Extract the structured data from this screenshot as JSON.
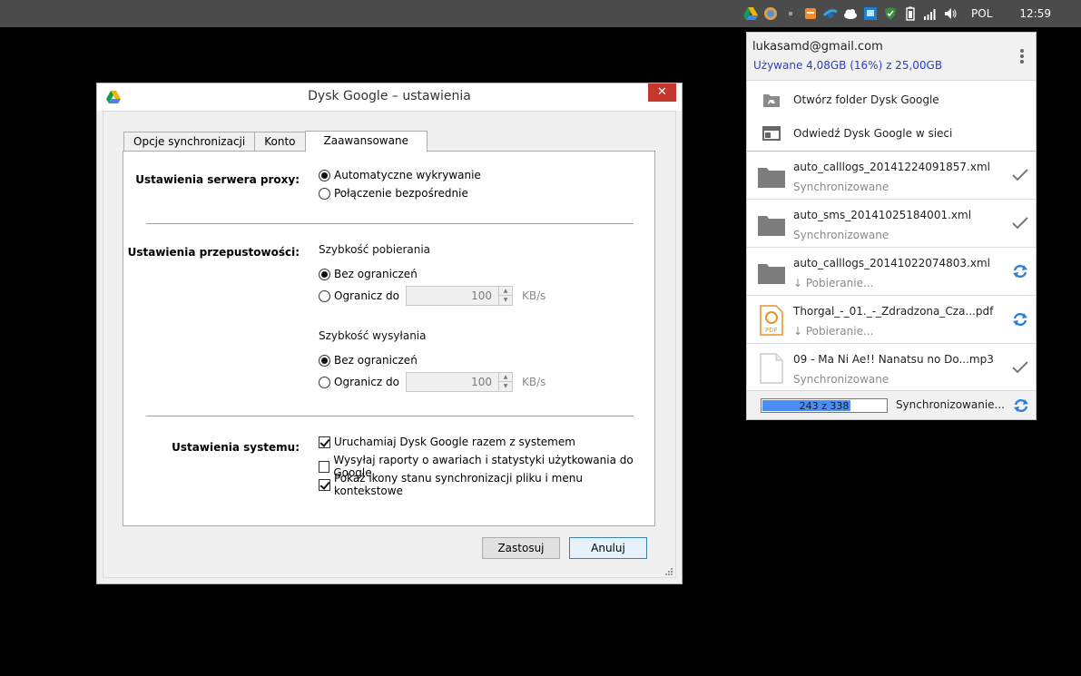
{
  "taskbar": {
    "tray_icons": [
      "google-drive-icon",
      "browser-icon",
      "small-app-icon",
      "orange-app-icon",
      "network-app-icon",
      "cloud-icon",
      "monitor-app-icon",
      "security-shield-icon",
      "battery-icon",
      "signal-bars-icon",
      "volume-icon"
    ],
    "language": "POL",
    "clock": "12:59"
  },
  "window": {
    "title": "Dysk Google – ustawienia",
    "close_label": "✕",
    "tabs": [
      {
        "label": "Opcje synchronizacji",
        "active": false
      },
      {
        "label": "Konto",
        "active": false
      },
      {
        "label": "Zaawansowane",
        "active": true
      }
    ],
    "proxy": {
      "label": "Ustawienia serwera proxy:",
      "options": [
        {
          "label": "Automatyczne wykrywanie",
          "selected": true
        },
        {
          "label": "Połączenie bezpośrednie",
          "selected": false
        }
      ]
    },
    "bandwidth": {
      "label": "Ustawienia przepustowości:",
      "download": {
        "title": "Szybkość pobierania",
        "unlimited_label": "Bez ograniczeń",
        "limit_label": "Ogranicz do",
        "value": "100",
        "unit": "KB/s",
        "selected": "unlimited"
      },
      "upload": {
        "title": "Szybkość wysyłania",
        "unlimited_label": "Bez ograniczeń",
        "limit_label": "Ogranicz do",
        "value": "100",
        "unit": "KB/s",
        "selected": "unlimited"
      }
    },
    "system": {
      "label": "Ustawienia systemu:",
      "options": [
        {
          "label": "Uruchamiaj Dysk Google razem z systemem",
          "checked": true
        },
        {
          "label": "Wysyłaj raporty o awariach i statystyki użytkowania do Google",
          "checked": false
        },
        {
          "label": "Pokaż ikony stanu synchronizacji pliku i menu kontekstowe",
          "checked": true
        }
      ]
    },
    "buttons": {
      "apply": "Zastosuj",
      "cancel": "Anuluj"
    }
  },
  "popup": {
    "email": "lukasamd@gmail.com",
    "usage": "Używane 4,08GB (16%) z 25,00GB",
    "actions": [
      {
        "label": "Otwórz folder Dysk Google",
        "icon": "drive-folder-icon"
      },
      {
        "label": "Odwiedź Dysk Google w sieci",
        "icon": "browser-window-icon"
      }
    ],
    "files": [
      {
        "name": "auto_calllogs_20141224091857.xml",
        "status": "Synchronizowane",
        "icon": "folder-icon",
        "state": "synced"
      },
      {
        "name": "auto_sms_20141025184001.xml",
        "status": "Synchronizowane",
        "icon": "folder-icon",
        "state": "synced"
      },
      {
        "name": "auto_calllogs_20141022074803.xml",
        "status": "↓ Pobieranie...",
        "icon": "folder-icon",
        "state": "syncing"
      },
      {
        "name": "Thorgal_-_01._-_Zdradzona_Cza...pdf",
        "status": "↓ Pobieranie...",
        "icon": "pdf-file-icon",
        "state": "syncing"
      },
      {
        "name": "09 - Ma Ni Ae!! Nanatsu no Do...mp3",
        "status": "Synchronizowane",
        "icon": "blank-file-icon",
        "state": "synced"
      }
    ],
    "progress": {
      "text": "243 z 338",
      "done": 243,
      "total": 338
    },
    "footer_status": "Synchronizowanie..."
  }
}
